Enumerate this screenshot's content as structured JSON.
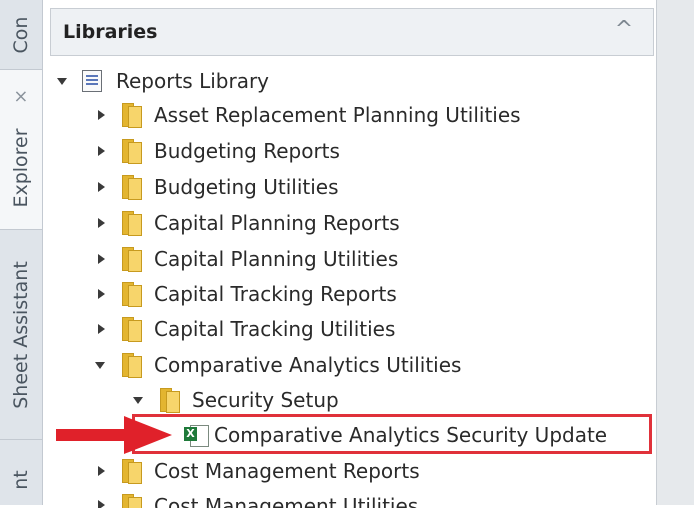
{
  "side_tabs": [
    {
      "label": "Con"
    },
    {
      "label": "Explorer",
      "close": "×"
    },
    {
      "label": "Sheet Assistant"
    },
    {
      "label": "nt"
    }
  ],
  "panel": {
    "title": "Libraries",
    "collapse_icon": "^"
  },
  "tree": [
    {
      "label": "Reports Library",
      "icon": "library-doc-icon",
      "expanded": true,
      "level": 0
    },
    {
      "label": "Asset Replacement Planning Utilities",
      "icon": "folder-icon",
      "expanded": false,
      "level": 1
    },
    {
      "label": "Budgeting Reports",
      "icon": "folder-icon",
      "expanded": false,
      "level": 1
    },
    {
      "label": "Budgeting Utilities",
      "icon": "folder-icon",
      "expanded": false,
      "level": 1
    },
    {
      "label": "Capital Planning Reports",
      "icon": "folder-icon",
      "expanded": false,
      "level": 1
    },
    {
      "label": "Capital Planning Utilities",
      "icon": "folder-icon",
      "expanded": false,
      "level": 1
    },
    {
      "label": "Capital Tracking Reports",
      "icon": "folder-icon",
      "expanded": false,
      "level": 1
    },
    {
      "label": "Capital Tracking Utilities",
      "icon": "folder-icon",
      "expanded": false,
      "level": 1
    },
    {
      "label": "Comparative Analytics Utilities",
      "icon": "folder-icon",
      "expanded": true,
      "level": 1
    },
    {
      "label": "Security Setup",
      "icon": "folder-icon",
      "expanded": true,
      "level": 2
    },
    {
      "label": "Comparative Analytics Security Update",
      "icon": "excel-file-icon",
      "level": 3,
      "highlighted": true
    },
    {
      "label": "Cost Management Reports",
      "icon": "folder-icon",
      "expanded": false,
      "level": 1
    },
    {
      "label": "Cost Management Utilities",
      "icon": "folder-icon",
      "expanded": false,
      "level": 1
    }
  ],
  "colors": {
    "highlight_border": "#e0313a",
    "arrow": "#e0212a",
    "folder": "#f7d56b"
  }
}
